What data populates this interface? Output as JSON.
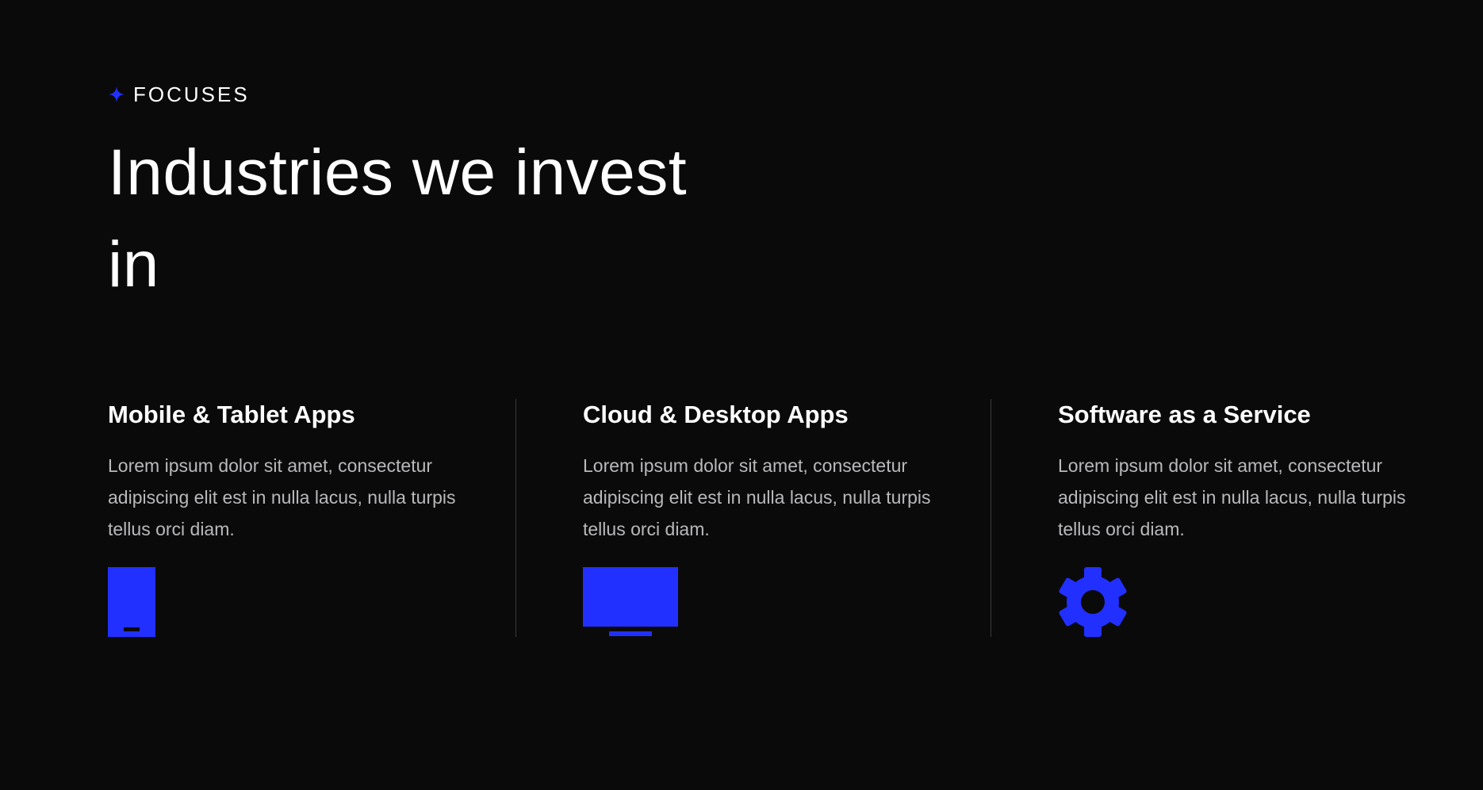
{
  "section": {
    "eyebrow": "FOCUSES",
    "eyebrow_icon": "sparkle-icon",
    "headline": "Industries we invest in"
  },
  "colors": {
    "background": "#0a0a0b",
    "accent": "#2230ff",
    "body_text": "#b9b9bc",
    "divider": "#3a3a3d"
  },
  "cards": [
    {
      "title": "Mobile & Tablet Apps",
      "text": "Lorem ipsum dolor sit amet, consectetur adipiscing elit est in nulla lacus, nulla turpis tellus orci diam.",
      "icon": "mobile-device-icon"
    },
    {
      "title": "Cloud & Desktop Apps",
      "text": "Lorem ipsum dolor sit amet, consectetur adipiscing elit est in nulla lacus, nulla turpis tellus orci diam.",
      "icon": "desktop-monitor-icon"
    },
    {
      "title": "Software as a Service",
      "text": "Lorem ipsum dolor sit amet, consectetur adipiscing elit est in nulla lacus, nulla turpis tellus orci diam.",
      "icon": "gear-icon"
    }
  ]
}
